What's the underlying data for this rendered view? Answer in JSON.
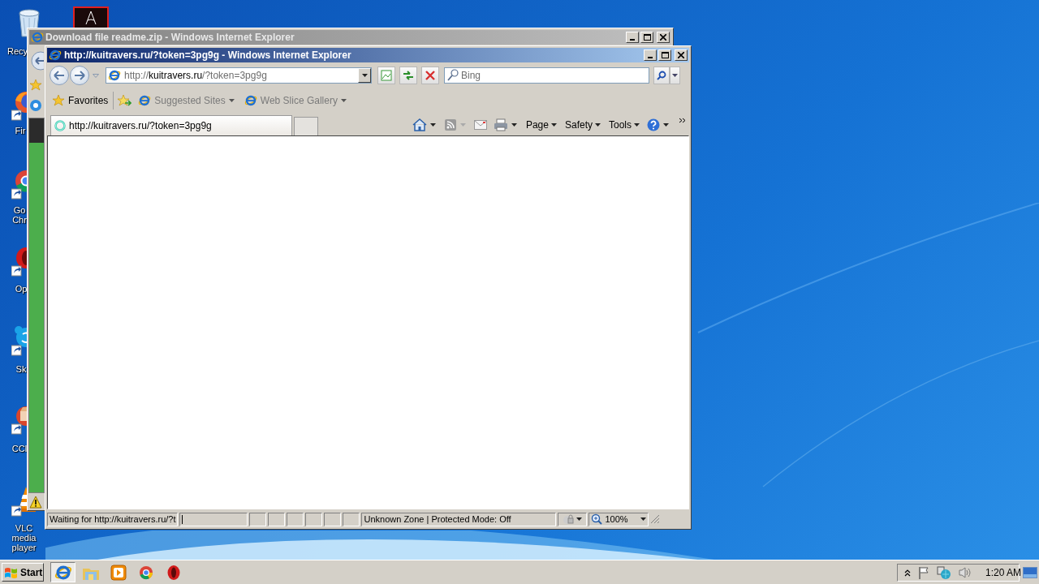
{
  "desktop": {
    "icons": [
      {
        "kind": "recycle",
        "label": "Recy"
      },
      {
        "kind": "pdf"
      },
      {
        "kind": "firefox",
        "label": "Fir"
      },
      {
        "kind": "chrome",
        "label": "Go Chr"
      },
      {
        "kind": "opera",
        "label": "Op"
      },
      {
        "kind": "skype",
        "label": "Sk"
      },
      {
        "kind": "ccleaner",
        "label": "CCl"
      },
      {
        "kind": "vlc",
        "label": "VLC media player"
      }
    ]
  },
  "back_window": {
    "title": "Download file readme.zip - Windows Internet Explorer",
    "active": false
  },
  "browser": {
    "title": "http://kuitravers.ru/?token=3pg9g - Windows Internet Explorer",
    "active": true,
    "address": {
      "scheme": "http://",
      "domain": "kuitravers.ru",
      "path": "/?token=3pg9g"
    },
    "search": {
      "placeholder": "Bing"
    },
    "favorites_bar": {
      "favorites": "Favorites",
      "links": [
        {
          "label": "Suggested Sites",
          "disabled": true
        },
        {
          "label": "Web Slice Gallery",
          "disabled": true
        }
      ]
    },
    "tabs": [
      {
        "label": "http://kuitravers.ru/?token=3pg9g",
        "selected": true
      }
    ],
    "command_bar": [
      {
        "kind": "home"
      },
      {
        "kind": "feeds"
      },
      {
        "kind": "mail"
      },
      {
        "kind": "print"
      },
      {
        "kind": "menu",
        "label": "Page"
      },
      {
        "kind": "menu",
        "label": "Safety"
      },
      {
        "kind": "menu",
        "label": "Tools"
      },
      {
        "kind": "help"
      },
      {
        "kind": "more"
      }
    ],
    "status_bar": {
      "progress": {
        "level": 0.01
      },
      "text": "Waiting for http://kuitravers.ru/?t",
      "zone": "Unknown Zone | Protected Mode: Off",
      "zoom": "100%"
    }
  },
  "taskbar": {
    "start": "Start",
    "apps": [
      {
        "kind": "ie",
        "active": true
      },
      {
        "kind": "explorer",
        "active": false
      },
      {
        "kind": "media",
        "active": false
      },
      {
        "kind": "chrome",
        "active": false
      },
      {
        "kind": "opera",
        "active": false
      }
    ],
    "clock": "1:20 AM"
  }
}
